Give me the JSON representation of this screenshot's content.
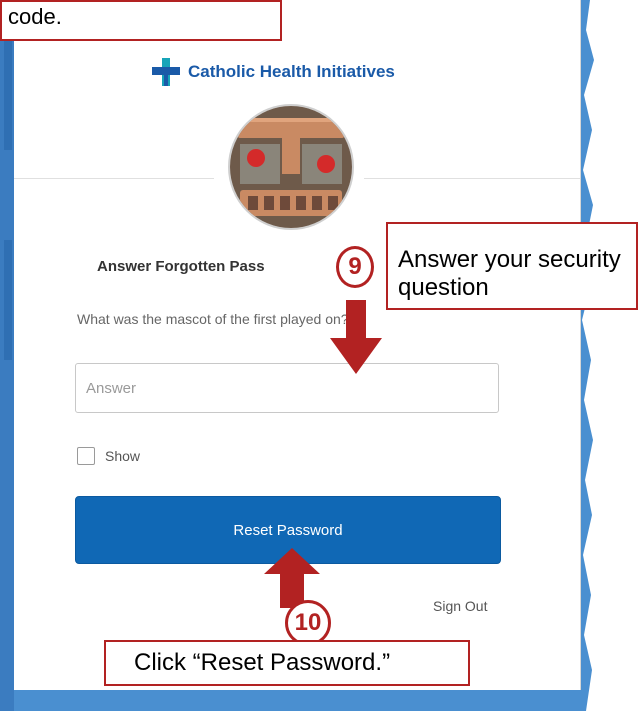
{
  "annotations": {
    "top_callout": "code.",
    "step9_number": "9",
    "step9_text": "Answer your security question",
    "step10_number": "10",
    "step10_text": "Click “Reset Password.”"
  },
  "org": {
    "name": "Catholic Health Initiatives"
  },
  "form": {
    "heading": "Answer Forgotten Pass",
    "question": "What was the mascot of the first played on?",
    "answer_placeholder": "Answer",
    "show_label": "Show",
    "submit_label": "Reset Password",
    "signout_label": "Sign Out"
  },
  "colors": {
    "accent": "#1068b5",
    "annotation_red": "#b22222",
    "background_blue": "#4a8fd0",
    "logo_blue": "#1a5aa8",
    "logo_teal": "#17a4b8"
  },
  "icons": {
    "logo": "cross-logo-icon",
    "avatar": "robot-face-avatar",
    "arrow": "red-arrow-icon"
  }
}
